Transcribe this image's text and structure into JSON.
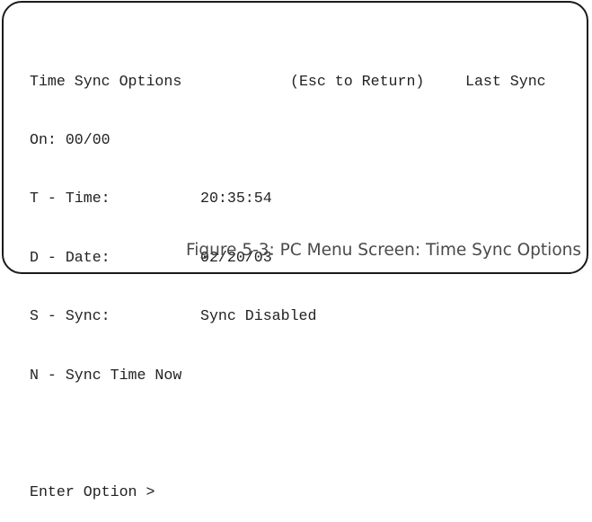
{
  "menu": {
    "title": "Time Sync Options",
    "return_hint": "(Esc to Return)",
    "last_sync_label": "Last Sync",
    "last_sync_line": "On: 00/00",
    "options": [
      {
        "label": "T - Time:",
        "value": "20:35:54"
      },
      {
        "label": "D - Date:",
        "value": "02/20/03"
      },
      {
        "label": "S - Sync:",
        "value": "Sync Disabled"
      }
    ],
    "sync_now": "N - Sync Time Now",
    "prompt": "Enter Option >"
  },
  "caption": "Figure 5-3: PC Menu Screen: Time Sync Options"
}
